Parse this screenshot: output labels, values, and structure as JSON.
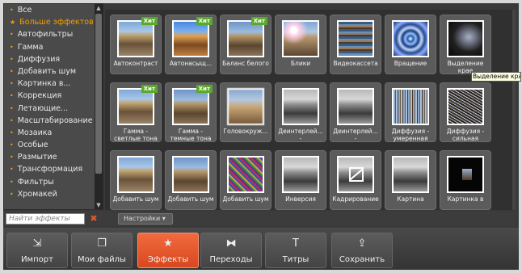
{
  "categories": [
    {
      "label": "Все",
      "selected": false
    },
    {
      "label": "Больше эффектов",
      "selected": true,
      "star": true
    },
    {
      "label": "Автофильтры",
      "selected": false
    },
    {
      "label": "Гамма",
      "selected": false
    },
    {
      "label": "Диффузия",
      "selected": false
    },
    {
      "label": "Добавить шум",
      "selected": false
    },
    {
      "label": "Картинка в...",
      "selected": false
    },
    {
      "label": "Коррекция",
      "selected": false
    },
    {
      "label": "Летающие...",
      "selected": false
    },
    {
      "label": "Масштабирование",
      "selected": false
    },
    {
      "label": "Мозаика",
      "selected": false
    },
    {
      "label": "Особые",
      "selected": false
    },
    {
      "label": "Размытие",
      "selected": false
    },
    {
      "label": "Трансформация",
      "selected": false
    },
    {
      "label": "Фильтры",
      "selected": false
    },
    {
      "label": "Хромакей",
      "selected": false
    }
  ],
  "hit_label": "Хит",
  "effects": [
    {
      "label": "Автоконтраст",
      "hit": true,
      "thumb": "col"
    },
    {
      "label": "Автонасыщ...",
      "hit": true,
      "thumb": "colsat"
    },
    {
      "label": "Баланс белого",
      "hit": true,
      "thumb": "col2"
    },
    {
      "label": "Блики",
      "hit": false,
      "thumb": "glare"
    },
    {
      "label": "Видеокассета",
      "hit": false,
      "thumb": "vhs"
    },
    {
      "label": "Вращение",
      "hit": false,
      "thumb": "swirl"
    },
    {
      "label": "Выделение крае",
      "hit": false,
      "thumb": "dark"
    },
    {
      "label": "Гамма - светлые тона",
      "hit": true,
      "thumb": "col"
    },
    {
      "label": "Гамма - темные тона",
      "hit": true,
      "thumb": "col2"
    },
    {
      "label": "Головокруж...",
      "hit": false,
      "thumb": "blurpic"
    },
    {
      "label": "Деинтерлей... -",
      "hit": false,
      "thumb": "colgray"
    },
    {
      "label": "Деинтерлей... -",
      "hit": false,
      "thumb": "colgray"
    },
    {
      "label": "Диффузия - умеренная",
      "hit": false,
      "thumb": "diff1"
    },
    {
      "label": "Диффузия - сильная",
      "hit": false,
      "thumb": "diff2"
    },
    {
      "label": "Добавить шум",
      "hit": false,
      "thumb": "col"
    },
    {
      "label": "Добавить шум",
      "hit": false,
      "thumb": "col2"
    },
    {
      "label": "Добавить шум",
      "hit": false,
      "thumb": "noise"
    },
    {
      "label": "Инверсия",
      "hit": false,
      "thumb": "colgray"
    },
    {
      "label": "Кадрирование",
      "hit": false,
      "thumb": "crop"
    },
    {
      "label": "Картина",
      "hit": false,
      "thumb": "colgray"
    },
    {
      "label": "Картинка в",
      "hit": false,
      "thumb": "blackpic"
    }
  ],
  "tooltip": "Выделение кра",
  "search": {
    "placeholder": "Найти эффекты"
  },
  "settings_label": "Настройки ▾",
  "toolbar": [
    {
      "label": "Импорт",
      "icon": "import-icon",
      "glyph": "⇲",
      "active": false
    },
    {
      "label": "Мои файлы",
      "icon": "files-icon",
      "glyph": "❐",
      "active": false
    },
    {
      "label": "Эффекты",
      "icon": "star-icon",
      "glyph": "★",
      "active": true
    },
    {
      "label": "Переходы",
      "icon": "transitions-icon",
      "glyph": "⧓",
      "active": false
    },
    {
      "label": "Титры",
      "icon": "titles-icon",
      "glyph": "T",
      "active": false
    },
    {
      "label": "Сохранить",
      "icon": "save-icon",
      "glyph": "⇪",
      "active": false
    }
  ],
  "colors": {
    "accent": "#f26a3e",
    "hit": "#5aa82c",
    "selected_category": "#f0a000"
  }
}
